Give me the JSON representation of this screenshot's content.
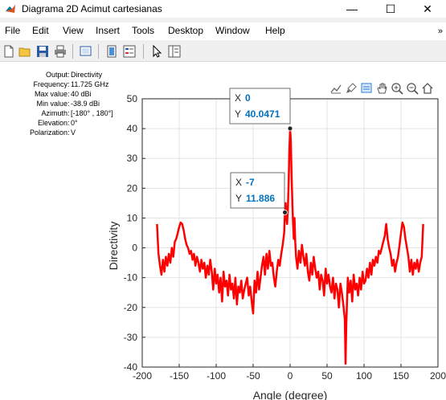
{
  "window": {
    "title": "Diagrama 2D Acimut cartesianas",
    "minimize_glyph": "—",
    "maximize_glyph": "☐",
    "close_glyph": "✕"
  },
  "menu": [
    "File",
    "Edit",
    "View",
    "Insert",
    "Tools",
    "Desktop",
    "Window",
    "Help"
  ],
  "menu_overflow_glyph": "»",
  "toolbar_icons": [
    "new-figure-icon",
    "open-file-icon",
    "save-icon",
    "print-icon",
    "link-plot-icon",
    "insert-colorbar-icon",
    "insert-legend-icon",
    "edit-plot-icon",
    "property-inspector-icon"
  ],
  "axes_toolbar_icons": [
    "export-icon",
    "brush-icon",
    "data-tips-icon",
    "pan-icon",
    "zoom-in-icon",
    "zoom-out-icon",
    "home-icon"
  ],
  "info": [
    {
      "label": "Output",
      "value": "Directivity"
    },
    {
      "label": "Frequency",
      "value": "11.725 GHz"
    },
    {
      "label": "Max value",
      "value": "40 dBi"
    },
    {
      "label": "Min value",
      "value": "-38.9 dBi"
    },
    {
      "label": "Azimuth",
      "value": "[-180° , 180°]"
    },
    {
      "label": "Elevation",
      "value": "0°"
    },
    {
      "label": "Polarization",
      "value": "V"
    }
  ],
  "chart_data": {
    "type": "line",
    "title": "",
    "xlabel": "Angle (degree)",
    "ylabel": "Directivity",
    "xlim": [
      -200,
      200
    ],
    "ylim": [
      -40,
      50
    ],
    "xticks": [
      -200,
      -150,
      -100,
      -50,
      0,
      50,
      100,
      150,
      200
    ],
    "yticks": [
      -40,
      -30,
      -20,
      -10,
      0,
      10,
      20,
      30,
      40,
      50
    ],
    "grid": true,
    "line_color": "#ff0000",
    "series": [
      {
        "x": [
          -180,
          -178,
          -176,
          -174,
          -172,
          -170,
          -168,
          -166,
          -164,
          -162,
          -160,
          -158,
          -156,
          -154,
          -152,
          -150,
          -148,
          -146,
          -144,
          -142,
          -140,
          -138,
          -136,
          -134,
          -132,
          -130,
          -128,
          -126,
          -124,
          -122,
          -120,
          -118,
          -116,
          -114,
          -112,
          -110,
          -108,
          -106,
          -104,
          -102,
          -100,
          -98,
          -96,
          -94,
          -92,
          -90,
          -88,
          -86,
          -84,
          -82,
          -80,
          -78,
          -76,
          -74,
          -72,
          -70,
          -68,
          -66,
          -64,
          -62,
          -60,
          -58,
          -56,
          -54,
          -52,
          -50,
          -48,
          -46,
          -44,
          -42,
          -40,
          -38,
          -36,
          -34,
          -32,
          -30,
          -28,
          -26,
          -24,
          -22,
          -20,
          -18,
          -16,
          -14,
          -12,
          -10,
          -8,
          -7,
          -6,
          -5,
          -4,
          -3,
          -2,
          -1,
          0,
          1,
          2,
          3,
          4,
          5,
          6,
          7,
          8,
          10,
          12,
          14,
          16,
          18,
          20,
          22,
          24,
          26,
          28,
          30,
          32,
          34,
          36,
          38,
          40,
          42,
          44,
          46,
          48,
          50,
          52,
          54,
          56,
          58,
          60,
          62,
          64,
          66,
          68,
          70,
          72,
          74,
          75,
          76,
          78,
          80,
          82,
          84,
          86,
          88,
          90,
          92,
          94,
          96,
          98,
          100,
          102,
          104,
          106,
          108,
          110,
          112,
          114,
          116,
          118,
          120,
          122,
          124,
          126,
          128,
          130,
          132,
          134,
          136,
          138,
          140,
          142,
          144,
          146,
          148,
          150,
          152,
          154,
          156,
          158,
          160,
          162,
          164,
          166,
          168,
          170,
          172,
          174,
          176,
          178,
          180
        ],
        "y": [
          8,
          -2,
          -6,
          -9,
          -4,
          -8,
          -3,
          -6,
          -2,
          -5,
          0,
          -3,
          2,
          3,
          5,
          7,
          8.5,
          8,
          6,
          3,
          1,
          0,
          -2,
          -1,
          -4,
          -2,
          -6,
          -3,
          -5,
          -8,
          -4,
          -7,
          -5,
          -10,
          -6,
          -9,
          -4,
          -8,
          -14,
          -7,
          -12,
          -9,
          -15,
          -10,
          -18,
          -8,
          -13,
          -11,
          -16,
          -9,
          -14,
          -12,
          -17,
          -10,
          -19,
          -13,
          -15,
          -11,
          -17,
          -14,
          -12,
          -10,
          -16,
          -13,
          -18,
          -22,
          -11,
          -15,
          -8,
          -14,
          -10,
          -6,
          -3,
          -9,
          -2,
          -7,
          -1,
          -6,
          -5,
          -10,
          -13,
          -8,
          -4,
          -6,
          -2,
          1,
          5,
          11.886,
          15,
          10,
          8,
          13,
          22,
          33,
          40.0471,
          36,
          25,
          15,
          8,
          3,
          10,
          2,
          -3,
          -7,
          -1,
          -5,
          1,
          -3,
          -6,
          -2,
          -8,
          -11,
          -5,
          -9,
          -3,
          -7,
          -10,
          -8,
          -14,
          -9,
          -11,
          -16,
          -7,
          -12,
          -9,
          -13,
          -15,
          -10,
          -17,
          -12,
          -14,
          -20,
          -12,
          -15,
          -19,
          -24,
          -38.9,
          -26,
          -10,
          -15,
          -11,
          -18,
          -9,
          -14,
          -12,
          -16,
          -10,
          -14,
          -8,
          -12,
          -11,
          -7,
          -10,
          -5,
          -9,
          -4,
          -6,
          -3,
          -5,
          -1,
          -2,
          0,
          2,
          4,
          8,
          3,
          0,
          -2,
          -6,
          -4,
          -8,
          -5,
          -3,
          1,
          5,
          8.5,
          7,
          3,
          0,
          -3,
          -8,
          -4,
          -9,
          -5,
          -7,
          -4,
          -8,
          -5,
          -3,
          8
        ]
      }
    ],
    "datatips": [
      {
        "x_label": "X",
        "x_value": "0",
        "y_label": "Y",
        "y_value": "40.0471",
        "x": 0,
        "y": 40.0471
      },
      {
        "x_label": "X",
        "x_value": "-7",
        "y_label": "Y",
        "y_value": "11.886",
        "x": -7,
        "y": 11.886
      }
    ]
  }
}
